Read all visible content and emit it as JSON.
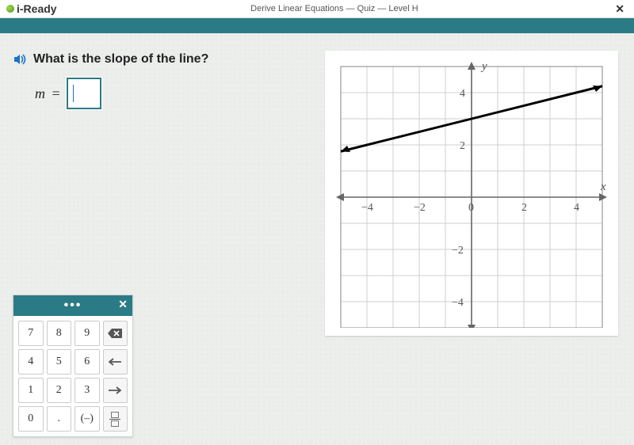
{
  "header": {
    "brand": "i-Ready",
    "breadcrumb": "Derive Linear Equations — Quiz — Level H"
  },
  "question": {
    "prompt": "What is the slope of the line?",
    "variable": "m",
    "equals": " ="
  },
  "chart_data": {
    "type": "line",
    "xlabel": "x",
    "ylabel": "y",
    "xlim": [
      -5,
      5
    ],
    "ylim": [
      -5,
      5
    ],
    "x_ticks": [
      "−4",
      "−2",
      "0",
      "2",
      "4"
    ],
    "y_ticks": [
      "4",
      "2",
      "−2",
      "−4"
    ],
    "series": [
      {
        "name": "line",
        "points": [
          {
            "x": -4,
            "y": 2
          },
          {
            "x": 0,
            "y": 3
          },
          {
            "x": 4,
            "y": 4
          }
        ],
        "slope": 0.25,
        "y_intercept": 3
      }
    ]
  },
  "keypad": {
    "keys": [
      "7",
      "8",
      "9",
      "4",
      "5",
      "6",
      "1",
      "2",
      "3",
      "0",
      ".",
      "(–)"
    ]
  }
}
